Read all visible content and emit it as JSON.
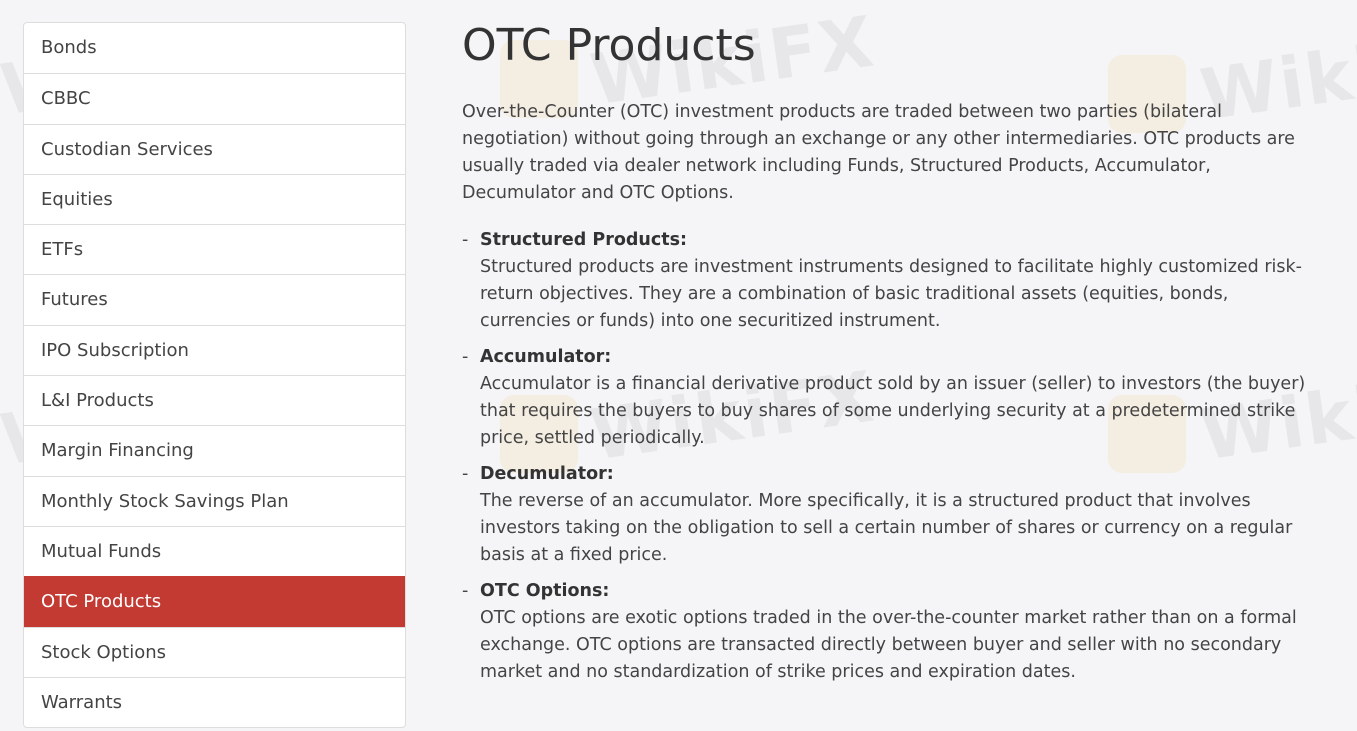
{
  "sidebar": {
    "items": [
      {
        "label": "Bonds",
        "active": false
      },
      {
        "label": "CBBC",
        "active": false
      },
      {
        "label": "Custodian Services",
        "active": false
      },
      {
        "label": "Equities",
        "active": false
      },
      {
        "label": "ETFs",
        "active": false
      },
      {
        "label": "Futures",
        "active": false
      },
      {
        "label": "IPO Subscription",
        "active": false
      },
      {
        "label": "L&I Products",
        "active": false
      },
      {
        "label": "Margin Financing",
        "active": false
      },
      {
        "label": "Monthly Stock Savings Plan",
        "active": false
      },
      {
        "label": "Mutual Funds",
        "active": false
      },
      {
        "label": "OTC Products",
        "active": true
      },
      {
        "label": "Stock Options",
        "active": false
      },
      {
        "label": "Warrants",
        "active": false
      }
    ]
  },
  "main": {
    "title": "OTC Products",
    "intro": "Over-the-Counter (OTC) investment products are traded between two parties (bilateral negotiation) without going through an exchange or any other intermediaries. OTC products are usually traded via dealer network including Funds, Structured Products, Accumulator, Decumulator and OTC Options.",
    "products": [
      {
        "dash": "-",
        "name": "Structured Products:",
        "desc": "Structured products are investment instruments designed to facilitate highly customized risk-return objectives. They are a combination of basic traditional assets (equities, bonds, currencies or funds) into one securitized instrument."
      },
      {
        "dash": "-",
        "name": "Accumulator:",
        "desc": "Accumulator is a financial derivative product sold by an issuer (seller) to investors (the buyer) that requires the buyers to buy shares of some underlying security at a predetermined strike price, settled periodically."
      },
      {
        "dash": "-",
        "name": "Decumulator:",
        "desc": "The reverse of an accumulator. More specifically, it is a structured product that involves investors taking on the obligation to sell a certain number of shares or currency on a regular basis at a fixed price."
      },
      {
        "dash": "-",
        "name": "OTC Options:",
        "desc": "OTC options are exotic options traded in the over-the-counter market rather than on a formal exchange. OTC options are transacted directly between buyer and seller with no secondary market and no standardization of strike prices and expiration dates."
      }
    ]
  },
  "watermark": {
    "text": "WikiFX"
  },
  "colors": {
    "accent": "#c33a32",
    "background": "#f5f5f7",
    "text": "#444444"
  }
}
